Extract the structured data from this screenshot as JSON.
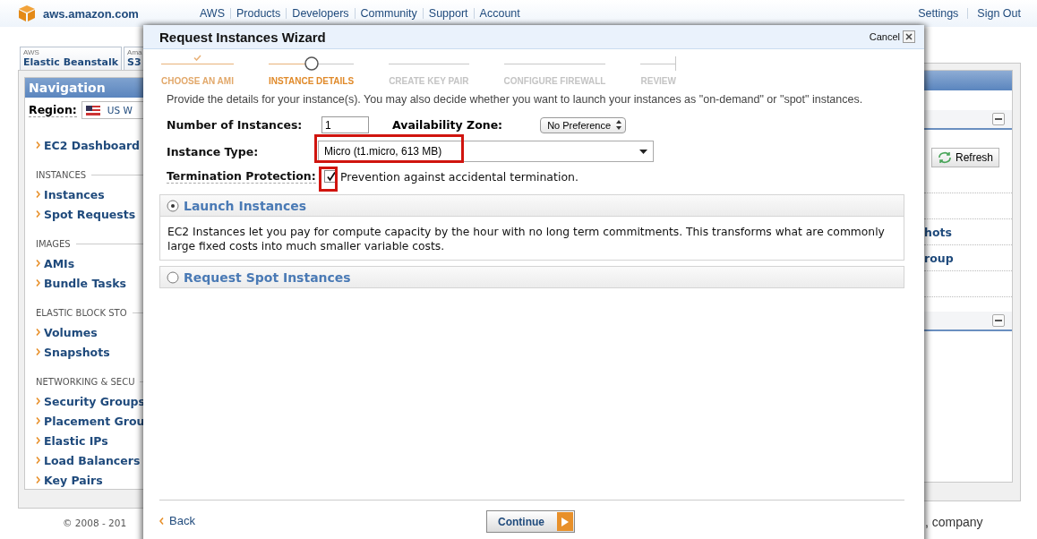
{
  "header": {
    "site": "aws.amazon.com",
    "links": [
      "AWS",
      "Products",
      "Developers",
      "Community",
      "Support",
      "Account"
    ],
    "settings": "Settings",
    "sign_out": "Sign Out"
  },
  "service_tabs": [
    {
      "group": "AWS",
      "label": "Elastic Beanstalk"
    },
    {
      "group": "Ama",
      "label": "S3"
    }
  ],
  "navigation": {
    "title": "Navigation",
    "region_label": "Region:",
    "region_value": "US W",
    "top_items": [
      "EC2 Dashboard"
    ],
    "groups": [
      {
        "heading": "INSTANCES",
        "items": [
          "Instances",
          "Spot Requests"
        ]
      },
      {
        "heading": "IMAGES",
        "items": [
          "AMIs",
          "Bundle Tasks"
        ]
      },
      {
        "heading": "ELASTIC BLOCK STO",
        "items": [
          "Volumes",
          "Snapshots"
        ]
      },
      {
        "heading": "NETWORKING & SECU",
        "items": [
          "Security Groups",
          "Placement Grou",
          "Elastic IPs",
          "Load Balancers",
          "Key Pairs"
        ]
      }
    ]
  },
  "right_panel": {
    "refresh_button": "Refresh",
    "links": [
      "hots",
      "roup"
    ]
  },
  "footer": {
    "copyright": "© 2008 - 201",
    "company": ", company"
  },
  "wizard": {
    "title": "Request Instances Wizard",
    "cancel": "Cancel",
    "steps": [
      {
        "label": "CHOOSE AN AMI",
        "done": true,
        "selected": false
      },
      {
        "label": "INSTANCE DETAILS",
        "done": false,
        "selected": true
      },
      {
        "label": "CREATE KEY PAIR",
        "done": false,
        "selected": false
      },
      {
        "label": "CONFIGURE FIREWALL",
        "done": false,
        "selected": false
      },
      {
        "label": "REVIEW",
        "done": false,
        "selected": false
      }
    ],
    "description": "Provide the details for your instance(s). You may also decide whether you want to launch your instances as \"on-demand\" or \"spot\" instances.",
    "number_of_instances": {
      "label": "Number of Instances:",
      "value": "1"
    },
    "availability_zone": {
      "label": "Availability Zone:",
      "value": "No Preference"
    },
    "instance_type": {
      "label": "Instance Type:",
      "value": "Micro (t1.micro, 613 MB)",
      "highlighted": true
    },
    "termination_protection": {
      "label": "Termination Protection:",
      "text": "Prevention against accidental termination.",
      "checked": true,
      "highlighted": true
    },
    "options": [
      {
        "title": "Launch Instances",
        "selected": true,
        "body": "EC2 Instances let you pay for compute capacity by the hour with no long term commitments. This transforms what are commonly large fixed costs into much smaller variable costs."
      },
      {
        "title": "Request Spot Instances",
        "selected": false
      }
    ],
    "back": "Back",
    "continue": "Continue"
  }
}
